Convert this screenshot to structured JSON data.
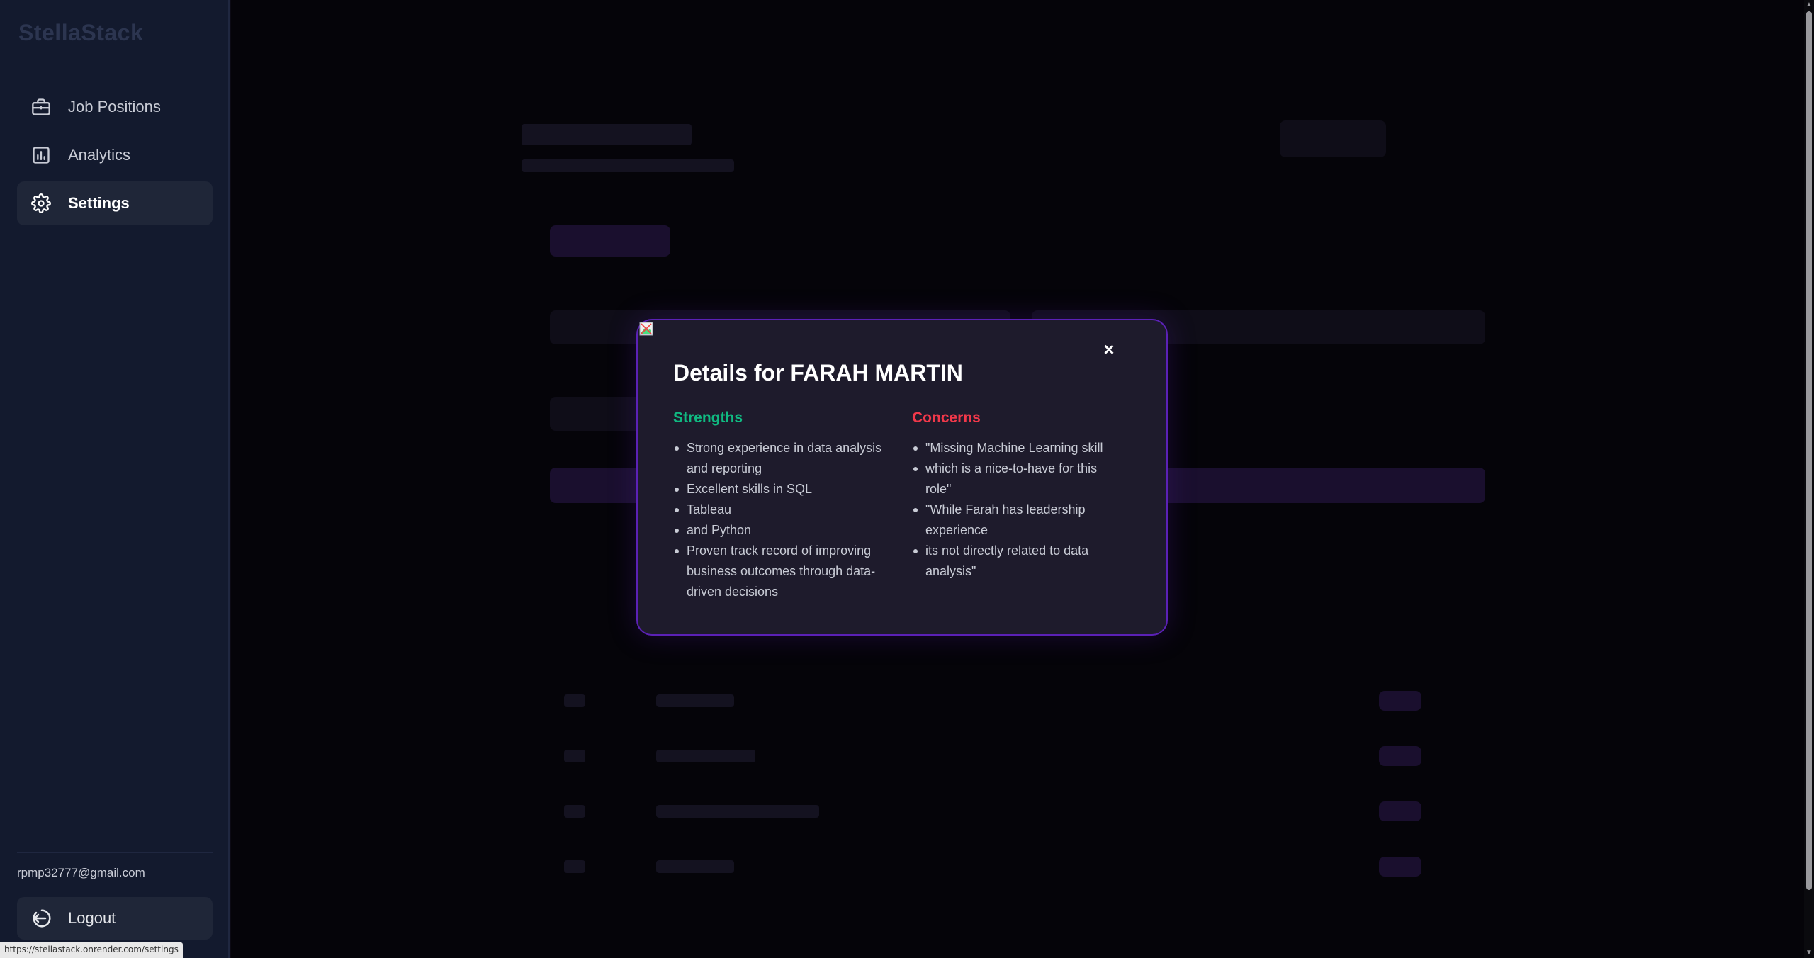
{
  "brand": "StellaStack",
  "nav": {
    "items": [
      {
        "label": "Job Positions",
        "icon": "briefcase-icon"
      },
      {
        "label": "Analytics",
        "icon": "bar-chart-icon"
      },
      {
        "label": "Settings",
        "icon": "gear-icon",
        "active": true
      }
    ]
  },
  "user": {
    "email": "rpmp32777@gmail.com"
  },
  "logout_label": "Logout",
  "status_url": "https://stellastack.onrender.com/settings",
  "modal": {
    "title": "Details for FARAH MARTIN",
    "close_symbol": "×",
    "strengths_heading": "Strengths",
    "strengths": [
      "Strong experience in data analysis and reporting",
      "Excellent skills in SQL",
      "Tableau",
      "and Python",
      "Proven track record of improving business outcomes through data-driven decisions"
    ],
    "concerns_heading": "Concerns",
    "concerns": [
      "\"Missing Machine Learning skill",
      "which is a nice-to-have for this role\"",
      "\"While Farah has leadership experience",
      "its not directly related to data analysis\""
    ]
  },
  "colors": {
    "strengths": "#10b981",
    "concerns": "#f0384a",
    "modal_border": "#5b21b6",
    "sidebar_bg": "#131a2e"
  }
}
